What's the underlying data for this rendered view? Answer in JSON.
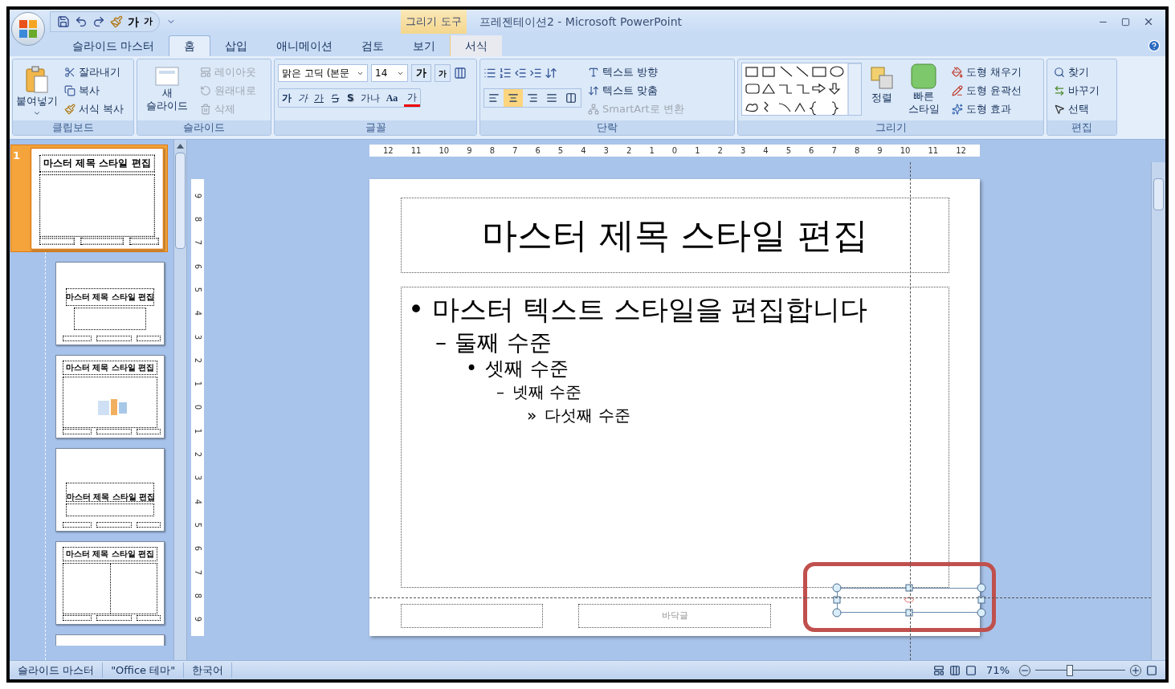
{
  "quick_access": {
    "grow_font": "가",
    "shrink_font": "가"
  },
  "title": "프레젠테이션2 - Microsoft PowerPoint",
  "context_tab_group": "그리기 도구",
  "tabs": [
    {
      "label": "슬라이드 마스터",
      "selected": false,
      "contextual": false
    },
    {
      "label": "홈",
      "selected": true,
      "contextual": false
    },
    {
      "label": "삽입",
      "selected": false,
      "contextual": false
    },
    {
      "label": "애니메이션",
      "selected": false,
      "contextual": false
    },
    {
      "label": "검토",
      "selected": false,
      "contextual": false
    },
    {
      "label": "보기",
      "selected": false,
      "contextual": false
    },
    {
      "label": "서식",
      "selected": false,
      "contextual": true
    }
  ],
  "ribbon": {
    "clipboard": {
      "label": "클립보드",
      "big": "붙여넣기",
      "items": [
        {
          "kind": "cut",
          "label": "잘라내기",
          "disabled": false
        },
        {
          "kind": "copy",
          "label": "복사",
          "disabled": false
        },
        {
          "kind": "brush",
          "label": "서식 복사",
          "disabled": false
        }
      ]
    },
    "slides": {
      "label": "슬라이드",
      "big": "새 슬라이드",
      "items": [
        {
          "kind": "layout",
          "label": "레이아웃",
          "disabled": true
        },
        {
          "kind": "reset",
          "label": "원래대로",
          "disabled": true
        },
        {
          "kind": "delete",
          "label": "삭제",
          "disabled": true
        }
      ]
    },
    "font": {
      "label": "글꼴",
      "font_name": "맑은 고딕 (본문",
      "font_size": "14",
      "grow": "가",
      "shrink": "가",
      "format_buttons": [
        {
          "kind": "bold",
          "label": "가"
        },
        {
          "kind": "italic",
          "label": "가"
        },
        {
          "kind": "underline",
          "label": "가"
        },
        {
          "kind": "strike"
        },
        {
          "kind": "shadow",
          "label": "S"
        },
        {
          "kind": "spacing",
          "label": "가나"
        },
        {
          "kind": "case",
          "label": "Aa"
        },
        {
          "kind": "color",
          "label": "가"
        }
      ]
    },
    "paragraph": {
      "label": "단락",
      "alignments": [
        {
          "kind": "left",
          "selected": false
        },
        {
          "kind": "center",
          "selected": true
        },
        {
          "kind": "right",
          "selected": false
        },
        {
          "kind": "justify",
          "selected": false
        },
        {
          "kind": "distributed",
          "selected": false
        }
      ],
      "items": [
        {
          "kind": "direction",
          "label": "텍스트 방향",
          "disabled": false
        },
        {
          "kind": "align",
          "label": "텍스트 맞춤",
          "disabled": false
        },
        {
          "kind": "smartart",
          "label": "SmartArt로 변환",
          "disabled": true
        }
      ]
    },
    "drawing": {
      "label": "그리기",
      "arrange": "정렬",
      "quick_styles": "빠른 스타일",
      "items": [
        {
          "kind": "fill",
          "label": "도형 채우기",
          "disabled": false
        },
        {
          "kind": "outline",
          "label": "도형 윤곽선",
          "disabled": false
        },
        {
          "kind": "effects",
          "label": "도형 효과",
          "disabled": false
        }
      ]
    },
    "editing": {
      "label": "편집",
      "items": [
        {
          "kind": "find",
          "label": "찾기",
          "disabled": false
        },
        {
          "kind": "replace",
          "label": "바꾸기",
          "disabled": false
        },
        {
          "kind": "select",
          "label": "선택",
          "disabled": false
        }
      ]
    }
  },
  "thumbnails": [
    {
      "number": "1",
      "selected": true,
      "kind": "title_body",
      "title": "마스터 제목 스타일 편집"
    },
    {
      "selected": false,
      "kind": "title_sub",
      "title": "마스터 제목 스타일 편집"
    },
    {
      "selected": false,
      "kind": "title_body_pic",
      "title": "마스터 제목 스타일 편집"
    },
    {
      "selected": false,
      "kind": "section",
      "title": "마스터 제목 스타일 편집"
    },
    {
      "selected": false,
      "kind": "two_content",
      "title": "마스터 제목 스타일 편집"
    },
    {
      "selected": false,
      "kind": "cut"
    }
  ],
  "ruler": {
    "horizontal": [
      "12",
      "11",
      "10",
      "9",
      "8",
      "7",
      "6",
      "5",
      "4",
      "3",
      "2",
      "1",
      "0",
      "1",
      "2",
      "3",
      "4",
      "5",
      "6",
      "7",
      "8",
      "9",
      "10",
      "11",
      "12"
    ],
    "vertical": [
      "9",
      "8",
      "7",
      "6",
      "5",
      "4",
      "3",
      "2",
      "1",
      "0",
      "1",
      "2",
      "3",
      "4",
      "5",
      "6",
      "7",
      "8",
      "9"
    ]
  },
  "slide": {
    "title": "마스터 제목 스타일 편집",
    "body": [
      {
        "bullet": "•",
        "text": "마스터 텍스트 스타일을 편집합니다",
        "children": [
          {
            "bullet": "–",
            "text": "둘째 수준",
            "children": [
              {
                "bullet": "•",
                "text": "셋째 수준",
                "children": [
                  {
                    "bullet": "–",
                    "text": "넷째 수준",
                    "children": [
                      {
                        "bullet": "»",
                        "text": "다섯째 수준"
                      }
                    ]
                  }
                ]
              }
            ]
          }
        ]
      }
    ],
    "footer": "바닥글"
  },
  "status_bar": {
    "items": [
      "슬라이드 마스터",
      "\"Office 테마\"",
      "한국어"
    ],
    "zoom": "71%",
    "zoom_slider": {
      "level": 0.38
    }
  }
}
